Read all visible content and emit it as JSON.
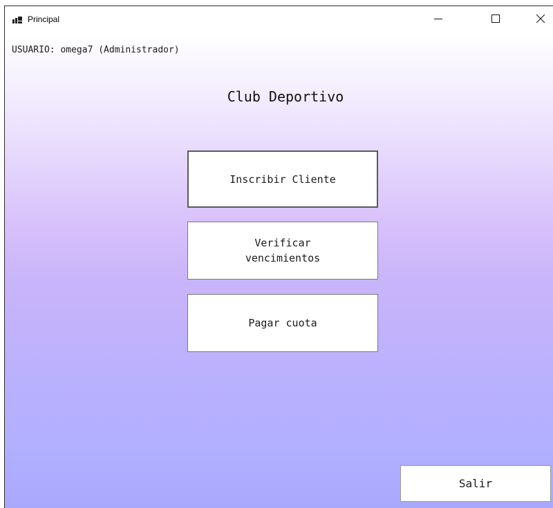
{
  "window": {
    "title": "Principal",
    "icon": "window-app-icon",
    "controls": {
      "minimize_icon": "minimize-icon",
      "maximize_icon": "maximize-icon",
      "close_icon": "close-icon"
    }
  },
  "header": {
    "user_label": "USUARIO: omega7 (Administrador)",
    "title": "Club Deportivo"
  },
  "menu": {
    "buttons": [
      {
        "label": "Inscribir Cliente"
      },
      {
        "label": "Verificar vencimientos"
      },
      {
        "label": "Pagar cuota"
      }
    ]
  },
  "footer": {
    "exit_label": "Salir"
  },
  "colors": {
    "gradient_top": "#ffffff",
    "gradient_middle": "#c9b4fa",
    "gradient_bottom": "#a9a8fd",
    "button_background": "#ffffff"
  }
}
